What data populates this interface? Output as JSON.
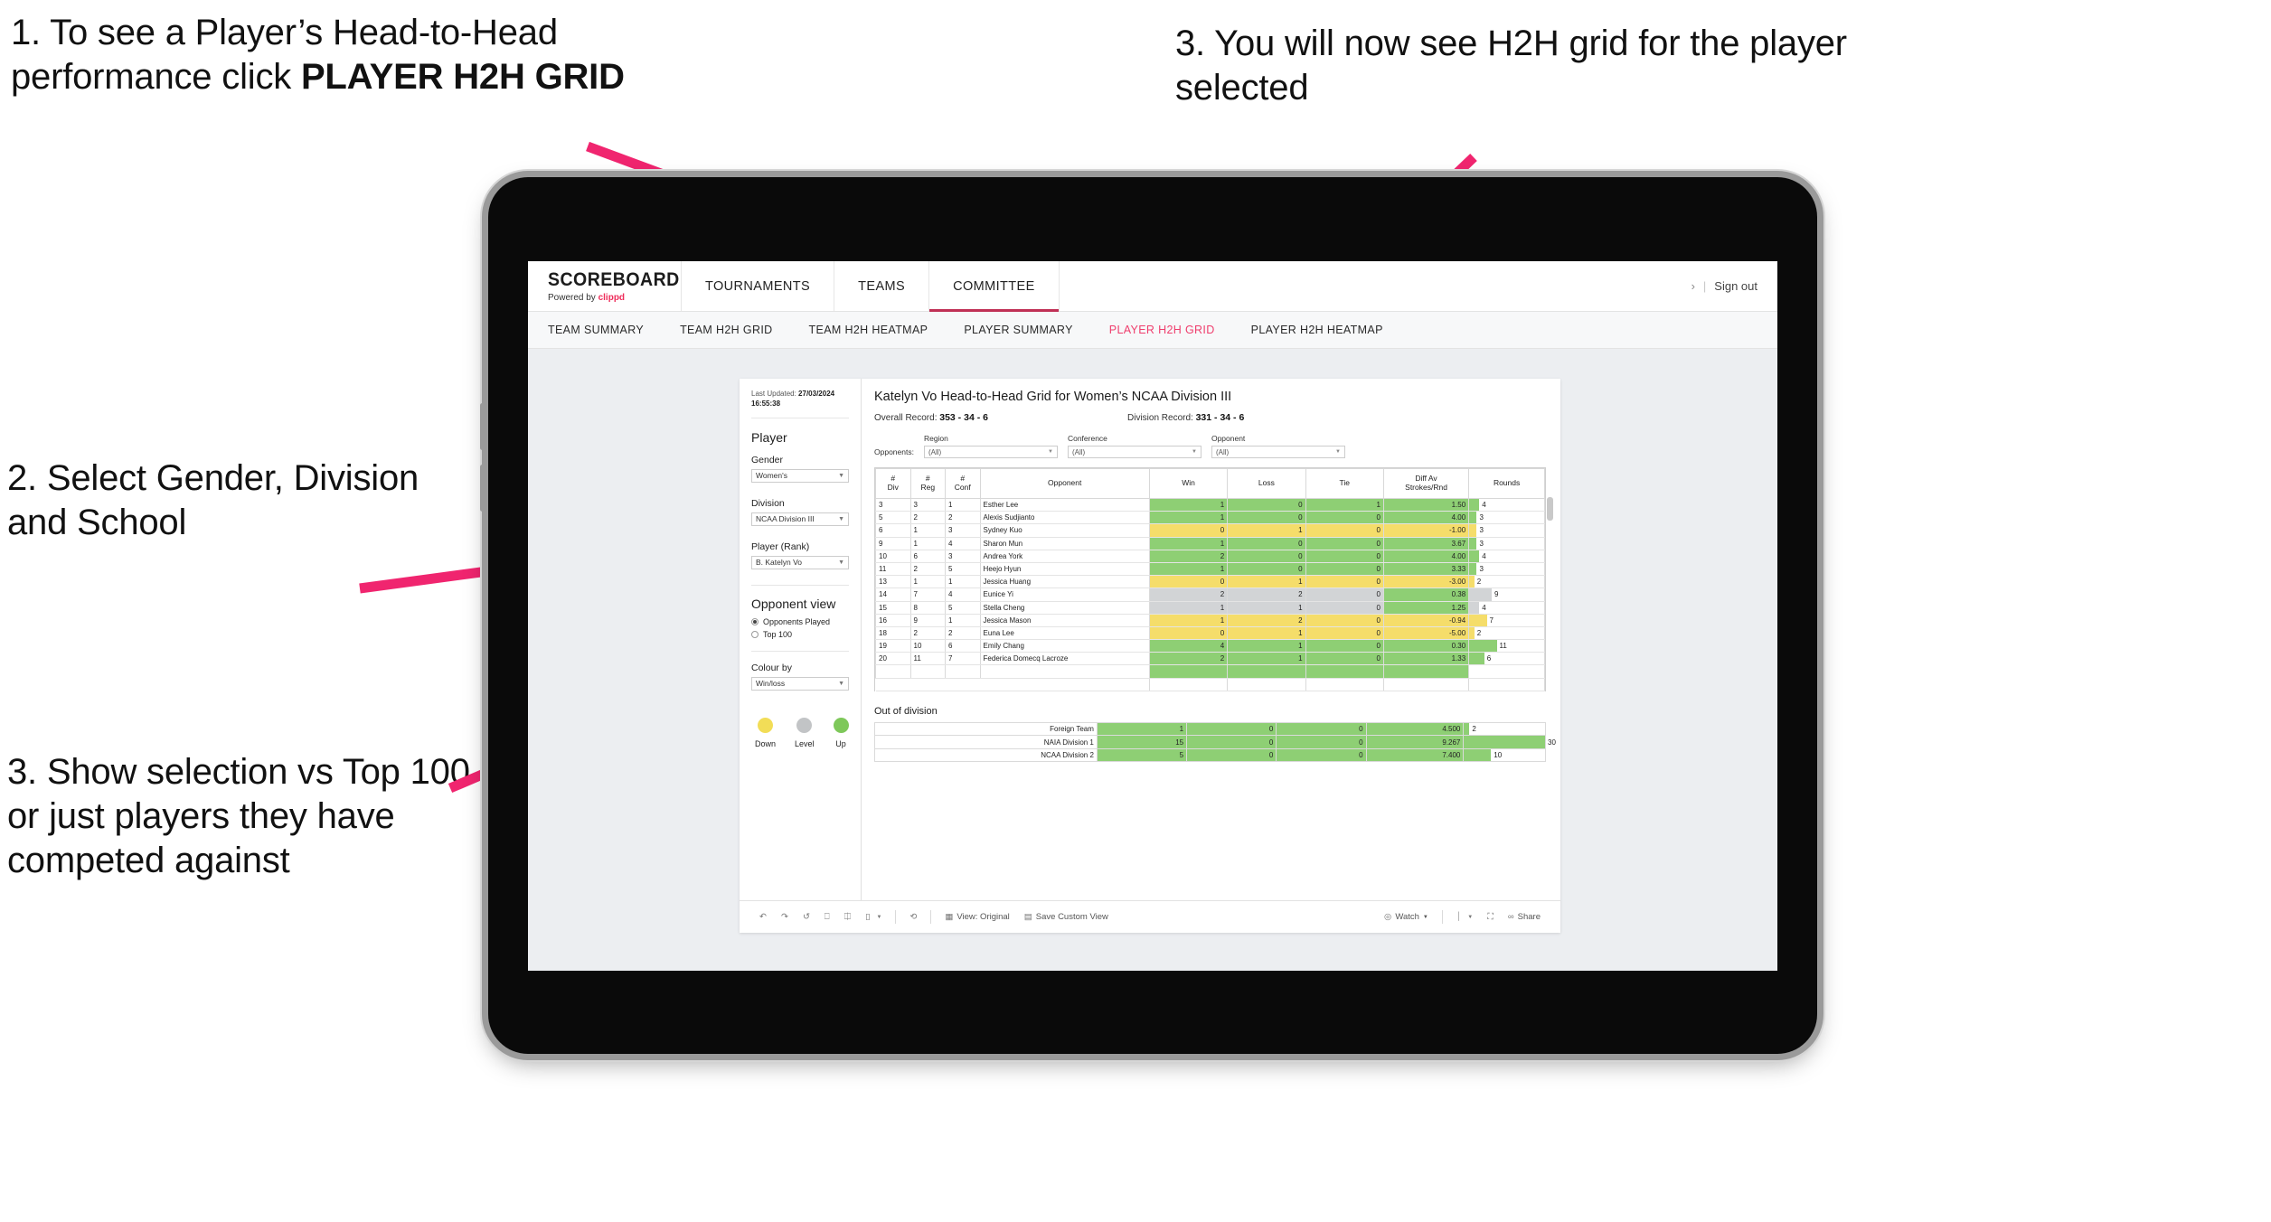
{
  "annotations": {
    "step1_a": "1. To see a Player’s Head-to-Head performance click ",
    "step1_b": "PLAYER H2H GRID",
    "step2": "2. Select Gender, Division and School",
    "step3": "3. Show selection vs Top 100 or just players they have competed against",
    "step4": "3. You will now see H2H grid for the player selected"
  },
  "header": {
    "brand_title": "SCOREBOARD",
    "brand_sub_pre": "Powered by ",
    "brand_sub_accent": "clippd",
    "nav": [
      {
        "label": "TOURNAMENTS",
        "active": false
      },
      {
        "label": "TEAMS",
        "active": false
      },
      {
        "label": "COMMITTEE",
        "active": true
      }
    ],
    "sign_out": "Sign out",
    "chevron": "›",
    "divider": "|"
  },
  "subnav": {
    "items": [
      {
        "label": "TEAM SUMMARY",
        "active": false
      },
      {
        "label": "TEAM H2H GRID",
        "active": false
      },
      {
        "label": "TEAM H2H HEATMAP",
        "active": false
      },
      {
        "label": "PLAYER SUMMARY",
        "active": false
      },
      {
        "label": "PLAYER H2H GRID",
        "active": true
      },
      {
        "label": "PLAYER H2H HEATMAP",
        "active": false
      }
    ]
  },
  "filters": {
    "last_updated_label": "Last Updated: ",
    "last_updated_value": "27/03/2024 16:55:38",
    "section_title": "Player",
    "gender_label": "Gender",
    "gender_value": "Women's",
    "division_label": "Division",
    "division_value": "NCAA Division III",
    "player_label": "Player (Rank)",
    "player_value": "B. Katelyn Vo",
    "opponent_view_title": "Opponent view",
    "opponent_view_options": [
      {
        "label": "Opponents Played",
        "selected": true
      },
      {
        "label": "Top 100",
        "selected": false
      }
    ],
    "colour_by_label": "Colour by",
    "colour_by_value": "Win/loss",
    "legend": [
      {
        "label": "Down",
        "color": "#f2dd57"
      },
      {
        "label": "Level",
        "color": "#c2c4c6"
      },
      {
        "label": "Up",
        "color": "#7ec85a"
      }
    ]
  },
  "viz": {
    "title": "Katelyn Vo Head-to-Head Grid for Women’s NCAA Division III",
    "overall_record_label": "Overall Record: ",
    "overall_record_value": "353 -  34 - 6",
    "division_record_label": "Division Record: ",
    "division_record_value": "331 -  34 - 6",
    "opponents_label": "Opponents:",
    "opponent_filters": [
      {
        "header": "Region",
        "value": "(All)"
      },
      {
        "header": "Conference",
        "value": "(All)"
      },
      {
        "header": "Opponent",
        "value": "(All)"
      }
    ],
    "columns": [
      "#\nDiv",
      "#\nReg",
      "#\nConf",
      "Opponent",
      "Win",
      "Loss",
      "Tie",
      "Diff Av\nStrokes/Rnd",
      "Rounds"
    ],
    "column_labels": {
      "div_a": "#",
      "div_b": "Div",
      "reg_a": "#",
      "reg_b": "Reg",
      "conf_a": "#",
      "conf_b": "Conf",
      "opponent": "Opponent",
      "win": "Win",
      "loss": "Loss",
      "tie": "Tie",
      "diff_a": "Diff Av",
      "diff_b": "Strokes/Rnd",
      "rounds": "Rounds"
    },
    "out_of_division_title": "Out of division"
  },
  "table_data": {
    "type": "table",
    "max_rounds": 30,
    "colors": {
      "up": "#8ecf74",
      "down": "#f5dd6a",
      "level": "#d2d4d6",
      "none": "#ffffff"
    },
    "rows": [
      {
        "div": "3",
        "reg": "3",
        "conf": "1",
        "opponent": "Esther Lee",
        "win": "1",
        "loss": "0",
        "tie": "1",
        "diff": "1.50",
        "rounds": "4",
        "state": "up"
      },
      {
        "div": "5",
        "reg": "2",
        "conf": "2",
        "opponent": "Alexis Sudjianto",
        "win": "1",
        "loss": "0",
        "tie": "0",
        "diff": "4.00",
        "rounds": "3",
        "state": "up"
      },
      {
        "div": "6",
        "reg": "1",
        "conf": "3",
        "opponent": "Sydney Kuo",
        "win": "0",
        "loss": "1",
        "tie": "0",
        "diff": "-1.00",
        "rounds": "3",
        "state": "down"
      },
      {
        "div": "9",
        "reg": "1",
        "conf": "4",
        "opponent": "Sharon Mun",
        "win": "1",
        "loss": "0",
        "tie": "0",
        "diff": "3.67",
        "rounds": "3",
        "state": "up"
      },
      {
        "div": "10",
        "reg": "6",
        "conf": "3",
        "opponent": "Andrea York",
        "win": "2",
        "loss": "0",
        "tie": "0",
        "diff": "4.00",
        "rounds": "4",
        "state": "up"
      },
      {
        "div": "11",
        "reg": "2",
        "conf": "5",
        "opponent": "Heejo Hyun",
        "win": "1",
        "loss": "0",
        "tie": "0",
        "diff": "3.33",
        "rounds": "3",
        "state": "up"
      },
      {
        "div": "13",
        "reg": "1",
        "conf": "1",
        "opponent": "Jessica Huang",
        "win": "0",
        "loss": "1",
        "tie": "0",
        "diff": "-3.00",
        "rounds": "2",
        "state": "down"
      },
      {
        "div": "14",
        "reg": "7",
        "conf": "4",
        "opponent": "Eunice Yi",
        "win": "2",
        "loss": "2",
        "tie": "0",
        "diff": "0.38",
        "rounds": "9",
        "state": "level",
        "diff_state": "up"
      },
      {
        "div": "15",
        "reg": "8",
        "conf": "5",
        "opponent": "Stella Cheng",
        "win": "1",
        "loss": "1",
        "tie": "0",
        "diff": "1.25",
        "rounds": "4",
        "state": "level",
        "diff_state": "up"
      },
      {
        "div": "16",
        "reg": "9",
        "conf": "1",
        "opponent": "Jessica Mason",
        "win": "1",
        "loss": "2",
        "tie": "0",
        "diff": "-0.94",
        "rounds": "7",
        "state": "down"
      },
      {
        "div": "18",
        "reg": "2",
        "conf": "2",
        "opponent": "Euna Lee",
        "win": "0",
        "loss": "1",
        "tie": "0",
        "diff": "-5.00",
        "rounds": "2",
        "state": "down"
      },
      {
        "div": "19",
        "reg": "10",
        "conf": "6",
        "opponent": "Emily Chang",
        "win": "4",
        "loss": "1",
        "tie": "0",
        "diff": "0.30",
        "rounds": "11",
        "state": "up"
      },
      {
        "div": "20",
        "reg": "11",
        "conf": "7",
        "opponent": "Federica Domecq Lacroze",
        "win": "2",
        "loss": "1",
        "tie": "0",
        "diff": "1.33",
        "rounds": "6",
        "state": "up"
      }
    ],
    "out_of_division": [
      {
        "label": "Foreign Team",
        "win": "1",
        "loss": "0",
        "tie": "0",
        "diff": "4.500",
        "rounds": "2",
        "state": "up"
      },
      {
        "label": "NAIA Division 1",
        "win": "15",
        "loss": "0",
        "tie": "0",
        "diff": "9.267",
        "rounds": "30",
        "state": "up"
      },
      {
        "label": "NCAA Division 2",
        "win": "5",
        "loss": "0",
        "tie": "0",
        "diff": "7.400",
        "rounds": "10",
        "state": "up"
      }
    ]
  },
  "toolbar": {
    "view_label": "View: Original",
    "save_label": "Save Custom View",
    "watch_label": "Watch",
    "share_label": "Share",
    "icons": {
      "undo": "↶",
      "redo": "↷",
      "revert": "↺",
      "refresh": "↻",
      "pause": "⏸",
      "caret": "▾"
    }
  }
}
